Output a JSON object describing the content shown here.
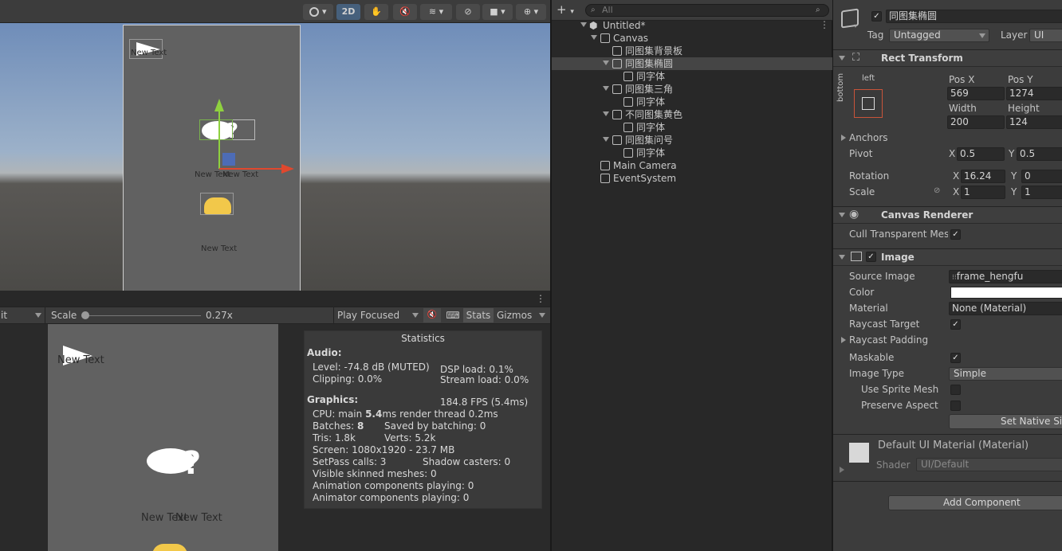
{
  "scene_toolbar": {
    "mode_2d": "2D"
  },
  "game_toolbar": {
    "display_fragment": "it",
    "scale_label": "Scale",
    "scale_value": "0.27x",
    "scale_fraction": 0.0,
    "play_mode": "Play Focused",
    "stats_label": "Stats",
    "gizmos_label": "Gizmos"
  },
  "scene": {
    "texts": [
      "New Text",
      "New Text",
      "New Text",
      "New Text"
    ]
  },
  "game": {
    "texts": [
      "New Text",
      "New Text",
      "New Text"
    ]
  },
  "stats": {
    "title": "Statistics",
    "audio_header": "Audio:",
    "level": "Level: -74.8 dB (MUTED)",
    "dsp": "DSP load: 0.1%",
    "clipping": "Clipping: 0.0%",
    "stream": "Stream load: 0.0%",
    "graphics_header": "Graphics:",
    "fps": "184.8 FPS (5.4ms)",
    "cpu_prefix": "CPU: main ",
    "cpu_main": "5.4",
    "cpu_suffix": "ms  render thread 0.2ms",
    "batches_prefix": "Batches: ",
    "batches": "8",
    "saved": "Saved by batching: 0",
    "tris": "Tris: 1.8k",
    "verts": "Verts: 5.2k",
    "screen": "Screen: 1080x1920 - 23.7 MB",
    "setpass": "SetPass calls: 3",
    "shadow": "Shadow casters: 0",
    "skinned": "Visible skinned meshes: 0",
    "animation": "Animation components playing: 0",
    "animator": "Animator components playing: 0"
  },
  "hierarchy": {
    "search_placeholder": "All",
    "scene_name": "Untitled*",
    "items": [
      {
        "label": "Canvas"
      },
      {
        "label": "同图集背景板"
      },
      {
        "label": "同图集椭圆"
      },
      {
        "label": "同字体"
      },
      {
        "label": "同图集三角"
      },
      {
        "label": "同字体"
      },
      {
        "label": "不同图集黄色"
      },
      {
        "label": "同字体"
      },
      {
        "label": "同图集问号"
      },
      {
        "label": "同字体"
      },
      {
        "label": "Main Camera"
      },
      {
        "label": "EventSystem"
      }
    ]
  },
  "inspector": {
    "object_name": "同图集椭圆",
    "tag_label": "Tag",
    "tag_value": "Untagged",
    "layer_label": "Layer",
    "layer_value": "UI",
    "rect_transform": {
      "title": "Rect Transform",
      "anchor_h": "left",
      "anchor_v": "bottom",
      "pos_x_label": "Pos X",
      "pos_y_label": "Pos Y",
      "pos_x": "569",
      "pos_y": "1274",
      "width_label": "Width",
      "height_label": "Height",
      "width": "200",
      "height": "124",
      "anchors": "Anchors",
      "pivot": "Pivot",
      "pivot_x": "0.5",
      "pivot_y": "0.5",
      "rotation": "Rotation",
      "rot_x": "16.24",
      "rot_y": "0",
      "scale": "Scale",
      "scale_x": "1",
      "scale_y": "1",
      "x": "X",
      "y": "Y"
    },
    "canvas_renderer": {
      "title": "Canvas Renderer",
      "cull": "Cull Transparent Mesh"
    },
    "image": {
      "title": "Image",
      "source_image_label": "Source Image",
      "source_image": "frame_hengfu",
      "color_label": "Color",
      "material_label": "Material",
      "material": "None (Material)",
      "raycast_target": "Raycast Target",
      "raycast_padding": "Raycast Padding",
      "maskable": "Maskable",
      "image_type_label": "Image Type",
      "image_type": "Simple",
      "use_sprite_mesh": "Use Sprite Mesh",
      "preserve_aspect": "Preserve Aspect",
      "set_native": "Set Native Size"
    },
    "material_block": {
      "name": "Default UI Material (Material)",
      "shader_label": "Shader",
      "shader": "UI/Default"
    },
    "add_component": "Add Component"
  }
}
